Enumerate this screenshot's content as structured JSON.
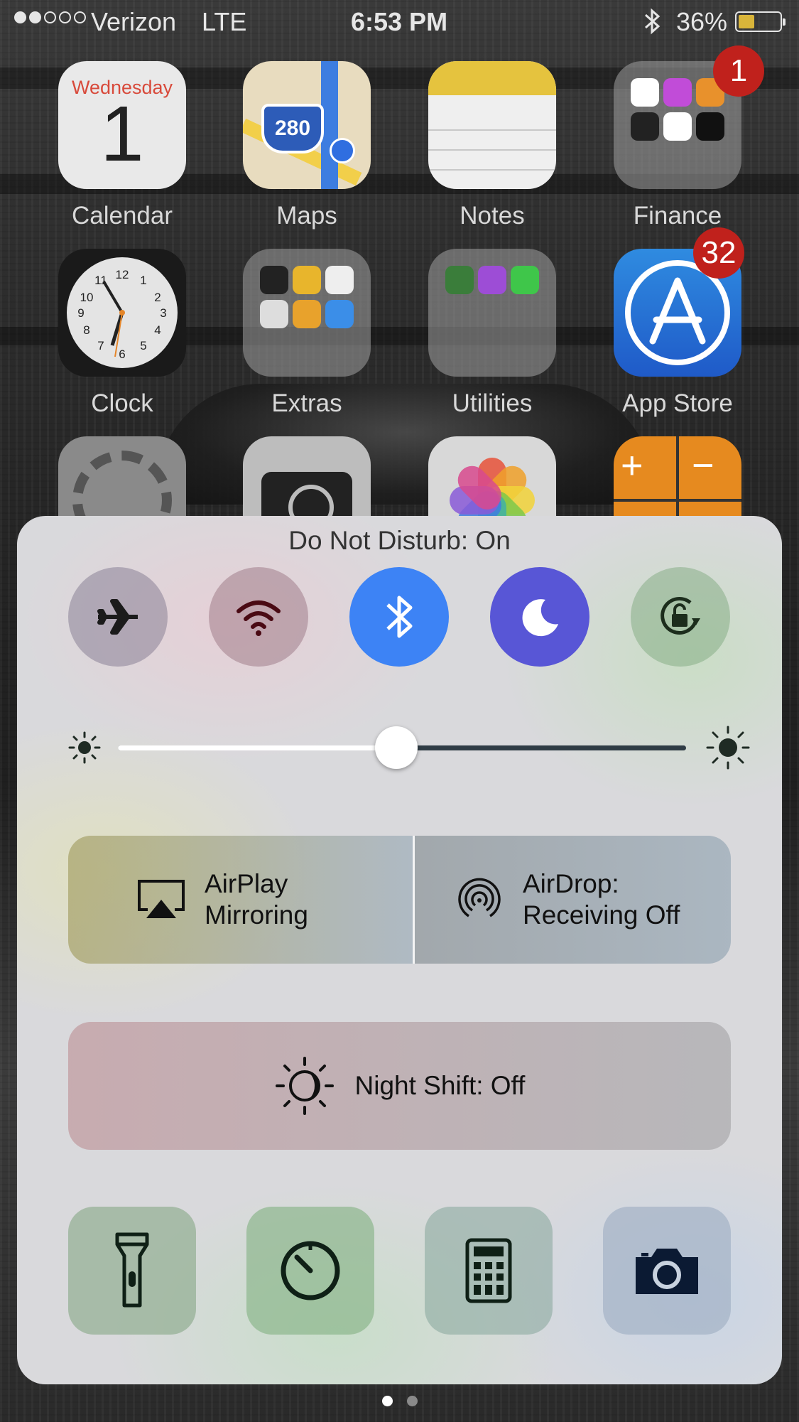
{
  "status_bar": {
    "carrier": "Verizon",
    "network": "LTE",
    "time": "6:53 PM",
    "battery_percent": "36%",
    "battery_level": 0.36,
    "signal_bars": 2,
    "icons": [
      "bluetooth-icon",
      "battery-icon"
    ]
  },
  "home_screen": {
    "apps": [
      {
        "label": "Calendar",
        "day": "Wednesday",
        "date": "1"
      },
      {
        "label": "Maps",
        "shield": "280"
      },
      {
        "label": "Notes"
      },
      {
        "label": "Finance",
        "badge": "1"
      },
      {
        "label": "Clock",
        "numerals": [
          "12",
          "1",
          "2",
          "3",
          "4",
          "5",
          "6",
          "7",
          "8",
          "9",
          "10",
          "11"
        ]
      },
      {
        "label": "Extras"
      },
      {
        "label": "Utilities"
      },
      {
        "label": "App Store",
        "badge": "32"
      },
      {
        "label": ""
      },
      {
        "label": ""
      },
      {
        "label": ""
      },
      {
        "label": "",
        "keys": [
          "+",
          "−"
        ]
      }
    ]
  },
  "control_center": {
    "title": "Do Not Disturb: On",
    "toggles": [
      {
        "icon": "airplane-icon",
        "state": "off"
      },
      {
        "icon": "wifi-icon",
        "state": "off"
      },
      {
        "icon": "bluetooth-icon",
        "state": "on",
        "color": "#3d83f5"
      },
      {
        "icon": "moon-icon",
        "state": "on",
        "color": "#5856d6"
      },
      {
        "icon": "rotation-lock-icon",
        "state": "off"
      }
    ],
    "brightness": 0.49,
    "airplay_label": "AirPlay\nMirroring",
    "airdrop_label": "AirDrop:\nReceiving Off",
    "night_shift_label": "Night Shift: Off",
    "shortcuts": [
      "flashlight-icon",
      "timer-icon",
      "calculator-icon",
      "camera-icon"
    ]
  },
  "pager": {
    "pages": 2,
    "active": 0
  }
}
